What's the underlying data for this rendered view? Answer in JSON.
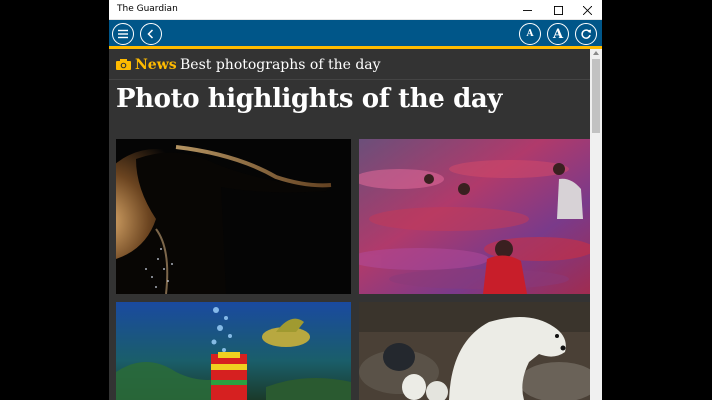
{
  "window": {
    "title": "The Guardian"
  },
  "toolbar": {
    "small_text_glyph": "A",
    "large_text_glyph": "A"
  },
  "section": {
    "label": "News",
    "subtitle": "Best photographs of the day"
  },
  "article": {
    "title": "Photo highlights of the day"
  },
  "photos": [
    {
      "name": "horse-silhouette-photo"
    },
    {
      "name": "crowd-motion-blur-photo"
    },
    {
      "name": "aquarium-lion-dance-photo"
    },
    {
      "name": "polar-bears-photo"
    }
  ],
  "colors": {
    "appbar": "#005689",
    "accent": "#ffbb00",
    "background": "#333333"
  }
}
